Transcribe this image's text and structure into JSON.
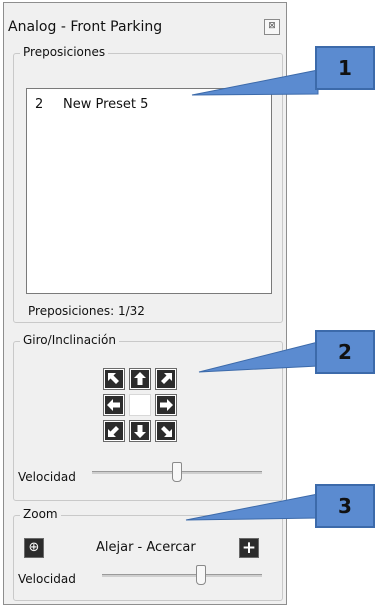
{
  "window": {
    "title": "Analog - Front Parking",
    "close_glyph": "⊠"
  },
  "presets": {
    "legend": "Preposiciones",
    "items": [
      {
        "number": "2",
        "name": "New Preset 5"
      }
    ],
    "count_label": "Preposiciones: 1/32"
  },
  "pan_tilt": {
    "legend": "Giro/Inclinación",
    "speed_label": "Velocidad",
    "speed_level": 0.5,
    "arrows": [
      "up-left",
      "up",
      "up-right",
      "left",
      "right",
      "down-left",
      "down",
      "down-right"
    ]
  },
  "zoom": {
    "legend": "Zoom",
    "out_glyph": "⊕",
    "in_glyph": "+",
    "label": "Alejar - Acercar",
    "speed_label": "Velocidad",
    "speed_level": 0.62
  },
  "callouts": [
    "1",
    "2",
    "3"
  ],
  "colors": {
    "callout": "#5b8bd0",
    "button": "#2c2c2c",
    "panel": "#f0f0f0"
  }
}
